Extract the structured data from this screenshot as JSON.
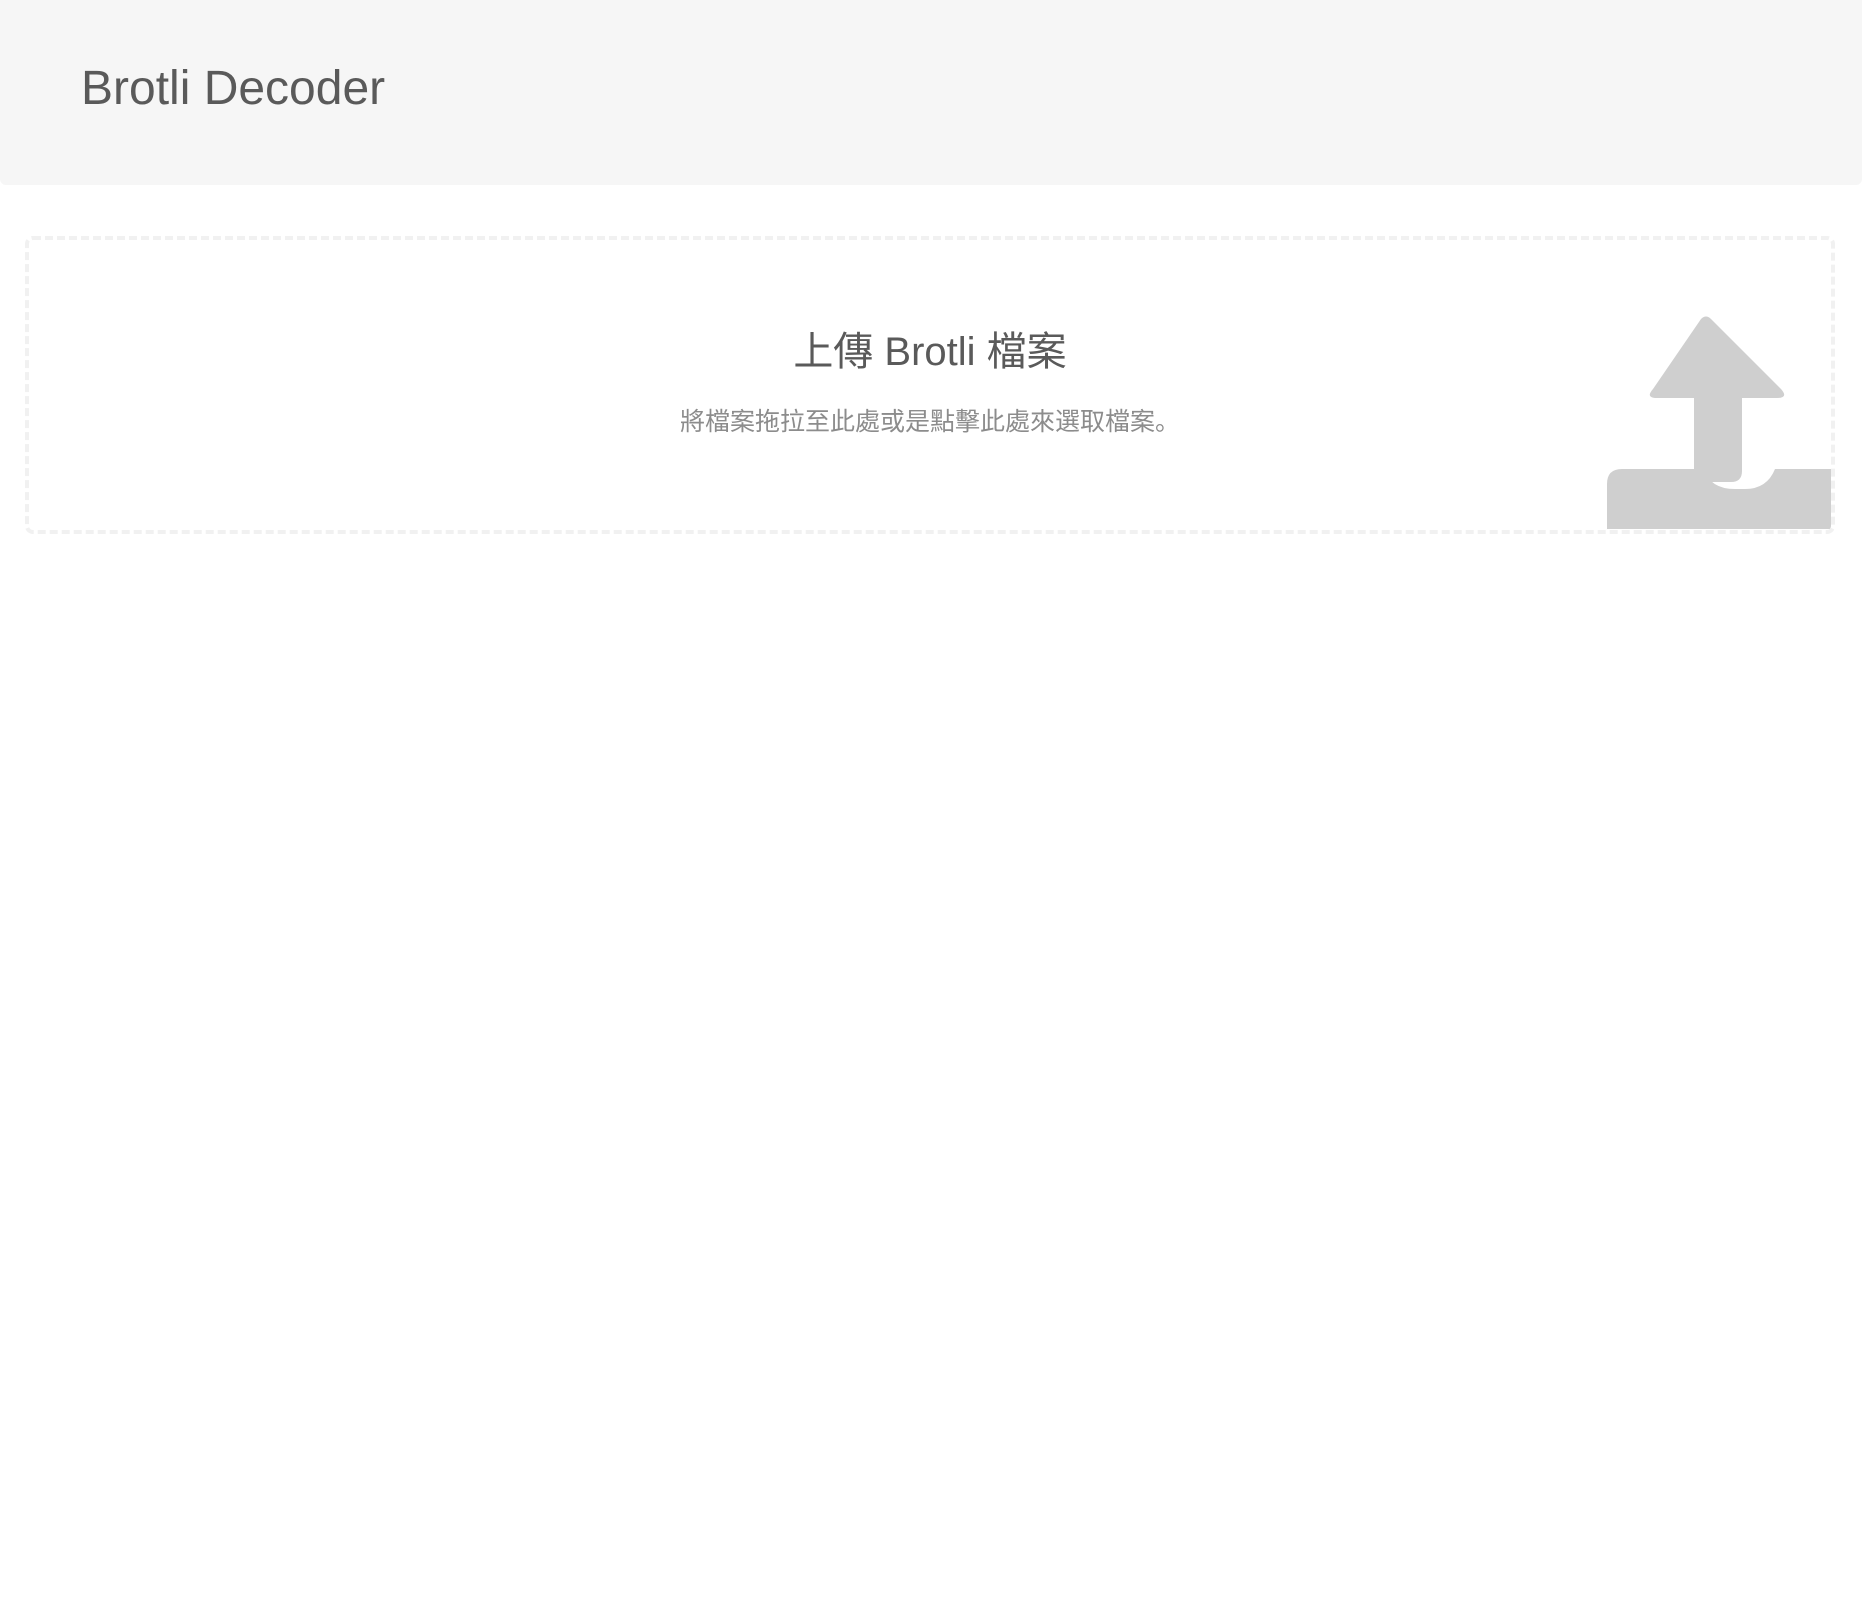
{
  "header": {
    "title": "Brotli Decoder"
  },
  "dropzone": {
    "title": "上傳 Brotli 檔案",
    "hint": "將檔案拖拉至此處或是點擊此處來選取檔案。",
    "icon": "upload-icon"
  },
  "colors": {
    "header_bg": "#f6f6f6",
    "text": "#5a5a5a",
    "hint_text": "#8c8c8c",
    "icon": "#cfcfcf",
    "dropzone_border": "#f1f1f1"
  }
}
